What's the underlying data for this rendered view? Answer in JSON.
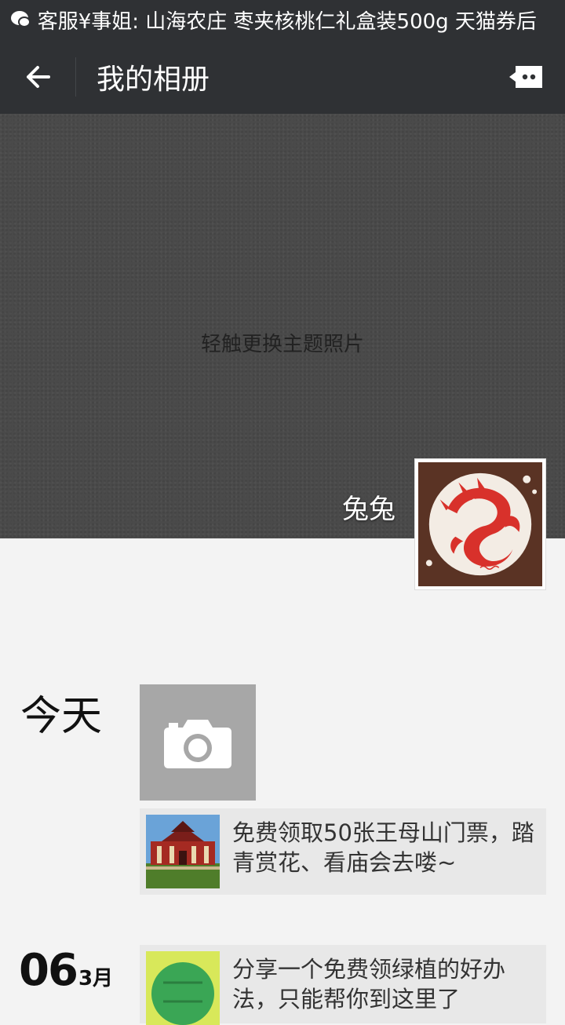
{
  "statusbar": {
    "notification": "客服¥事姐: 山海农庄 枣夹核桃仁礼盒装500g 天猫券后"
  },
  "appbar": {
    "title": "我的相册"
  },
  "cover": {
    "hint": "轻触更换主题照片",
    "nickname": "兔兔"
  },
  "feed": {
    "today_label": "今天",
    "posts": [
      {
        "text": "免费领取50张王母山门票，踏青赏花、看庙会去喽~"
      }
    ],
    "groups": [
      {
        "day": "06",
        "month": "3月",
        "posts": [
          {
            "text": "分享一个免费领绿植的好办法，只能帮你到这里了"
          }
        ]
      }
    ]
  },
  "colors": {
    "bar": "#2f3134",
    "cover": "#4a4a4a",
    "page": "#f3f3f3",
    "card": "#e8e8e8",
    "camera_tile": "#a7a7a7",
    "avatar_bg": "#5a3324",
    "avatar_art": "#d8312b"
  }
}
